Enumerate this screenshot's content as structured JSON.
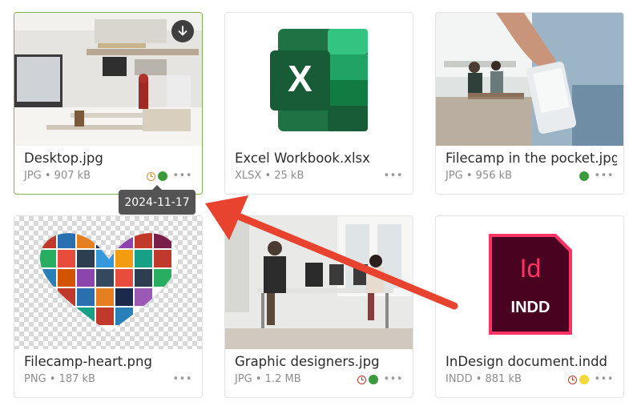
{
  "files": [
    {
      "name": "Desktop.jpg",
      "meta": "JPG • 907 kB",
      "thumbnail": "photo-office-desk",
      "statuses": [
        "clock-orange",
        "dot-green"
      ],
      "selected": true,
      "more_label": "•••"
    },
    {
      "name": "Excel Workbook.xlsx",
      "meta": "XLSX • 25 kB",
      "thumbnail": "excel-icon",
      "statuses": [],
      "more_label": "•••"
    },
    {
      "name": "Filecamp in the pocket.jpg",
      "meta": "JPG • 956 kB",
      "thumbnail": "photo-phone-in-pocket",
      "statuses": [
        "dot-green"
      ],
      "more_label": "•••"
    },
    {
      "name": "Filecamp-heart.png",
      "meta": "PNG • 187 kB",
      "thumbnail": "heart-of-app-icons",
      "statuses": [],
      "more_label": "•••"
    },
    {
      "name": "Graphic designers.jpg",
      "meta": "JPG • 1.2 MB",
      "thumbnail": "photo-designers-office",
      "statuses": [
        "clock-red",
        "dot-green"
      ],
      "more_label": "•••"
    },
    {
      "name": "InDesign document.indd",
      "meta": "INDD • 881 kB",
      "thumbnail": "indesign-icon",
      "statuses": [
        "clock-red",
        "dot-yellow"
      ],
      "more_label": "•••"
    }
  ],
  "excel_icon_letter": "X",
  "indd_icon": {
    "letters": "Id",
    "ext": "INDD"
  },
  "tooltip": {
    "text": "2024-11-17"
  },
  "icons": {
    "download": "download-icon",
    "arrow": "red-arrow-annotation"
  },
  "colors": {
    "selected_border": "#7fb24f",
    "status_green": "#3b9a3b",
    "status_yellow": "#f4d83a",
    "clock_red": "#c0392b",
    "clock_orange": "#e08a2e",
    "annotation_red": "#e8432f",
    "excel_green": "#217346",
    "indesign_pink": "#ff3366"
  }
}
